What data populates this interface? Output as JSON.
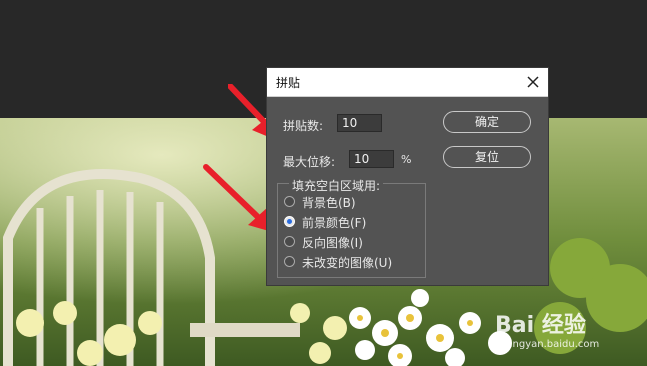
{
  "dialog": {
    "title": "拼贴",
    "fields": {
      "tile_count_label": "拼贴数:",
      "tile_count_value": "10",
      "max_offset_label": "最大位移:",
      "max_offset_value": "10",
      "max_offset_unit": "%"
    },
    "buttons": {
      "ok": "确定",
      "reset": "复位"
    },
    "fill_group": {
      "title": "填充空白区域用:",
      "options": [
        {
          "label": "背景色(B)",
          "checked": false
        },
        {
          "label": "前景颜色(F)",
          "checked": true
        },
        {
          "label": "反向图像(I)",
          "checked": false
        },
        {
          "label": "未改变的图像(U)",
          "checked": false
        }
      ]
    }
  },
  "watermark": {
    "main": "Bai 经验",
    "sub": "jingyan.baidu.com"
  },
  "colors": {
    "panel": "#535353",
    "arrow": "#e8202a",
    "titlebar": "#ffffff"
  }
}
